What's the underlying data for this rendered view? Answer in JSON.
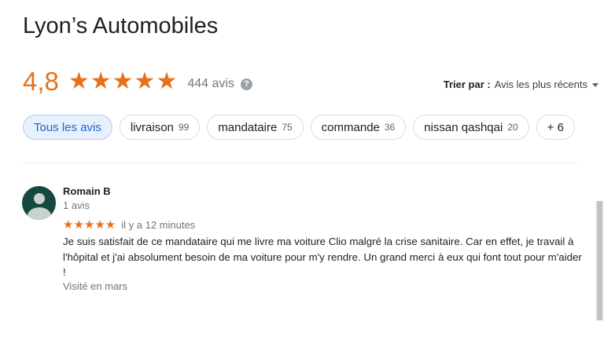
{
  "business": {
    "name": "Lyon’s Automobiles",
    "rating": "4,8",
    "stars": "★★★★★",
    "review_count": "444 avis",
    "help_icon": "?"
  },
  "sort": {
    "label": "Trier par :",
    "value": "Avis les plus récents"
  },
  "chips": [
    {
      "label": "Tous les avis",
      "count": "",
      "active": true
    },
    {
      "label": "livraison",
      "count": "99"
    },
    {
      "label": "mandataire",
      "count": "75"
    },
    {
      "label": "commande",
      "count": "36"
    },
    {
      "label": "nissan qashqai",
      "count": "20"
    },
    {
      "label": "+ 6",
      "count": ""
    }
  ],
  "review": {
    "author": "Romain B",
    "author_reviews": "1 avis",
    "stars": "★★★★★",
    "rating": 5,
    "time": "il y a 12 minutes",
    "text": "Je suis satisfait de ce mandataire qui me livre ma voiture Clio malgré la crise sanitaire. Car en effet, je travail à l'hôpital et j'ai absolument besoin de ma voiture pour m'y rendre. Un grand merci à eux qui font tout pour m'aider !",
    "visited": "Visité en mars"
  },
  "colors": {
    "accent": "#e7711b",
    "chip_active_bg": "#e8f0fe",
    "chip_active_text": "#1967d2",
    "avatar_bg": "#15493f"
  },
  "icons": {
    "help": "help-circle-icon",
    "sort_caret": "caret-down-icon",
    "avatar": "person-icon"
  }
}
